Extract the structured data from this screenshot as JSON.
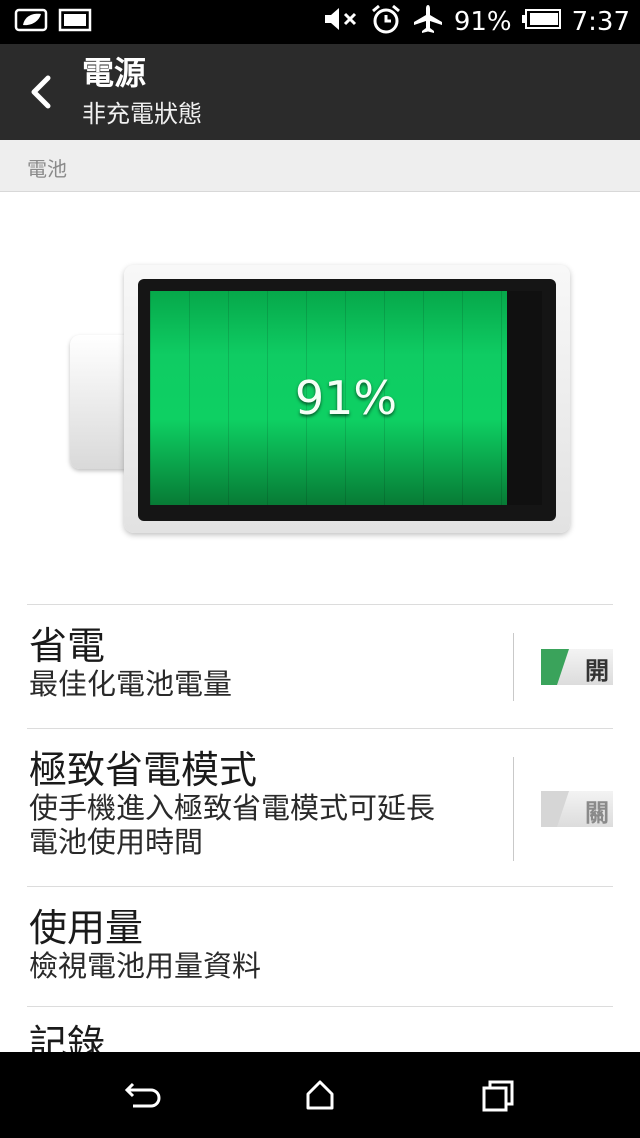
{
  "status_bar": {
    "battery_percent": "91%",
    "time": "7:37",
    "icons_left": [
      "leaf-icon",
      "gallery-icon"
    ],
    "icons_right": [
      "mute-icon",
      "alarm-icon",
      "airplane-icon",
      "battery-icon"
    ]
  },
  "action_bar": {
    "title": "電源",
    "subtitle": "非充電狀態"
  },
  "section": {
    "header": "電池"
  },
  "battery": {
    "level": 0.91,
    "label": "91%",
    "fill_color": "#0fcc63"
  },
  "list": [
    {
      "title": "省電",
      "desc": "最佳化電池電量",
      "toggle_label": "開",
      "toggle_on": true
    },
    {
      "title": "極致省電模式",
      "desc_line1": "使手機進入極致省電模式可延長",
      "desc_line2": "電池使用時間",
      "toggle_label": "關",
      "toggle_on": false
    },
    {
      "title": "使用量",
      "desc": "檢視電池用量資料"
    },
    {
      "title": "記錄"
    }
  ],
  "colors": {
    "action_bar": "#2b2b2b",
    "toggle_on": "#3aa35b",
    "toggle_off": "#cfcfcf"
  },
  "navbar": [
    "back-icon",
    "home-icon",
    "recent-apps-icon"
  ]
}
